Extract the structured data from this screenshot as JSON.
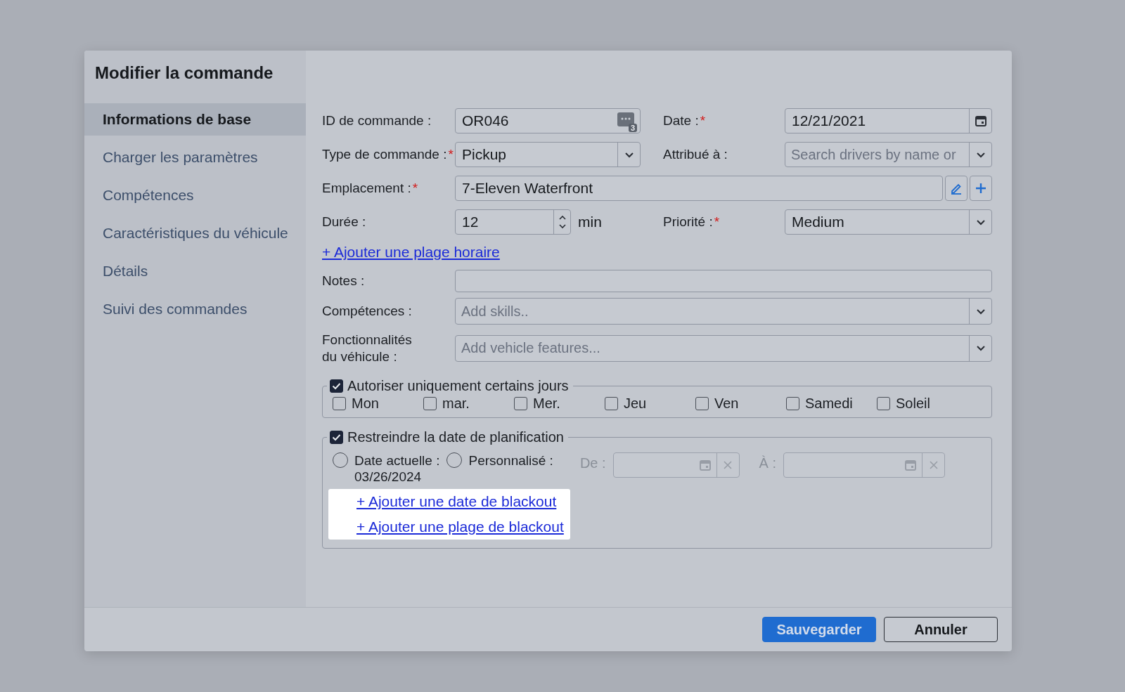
{
  "dialog": {
    "title": "Modifier la commande"
  },
  "sidebar": {
    "items": [
      {
        "label": "Informations de base",
        "selected": true
      },
      {
        "label": "Charger les paramètres",
        "selected": false
      },
      {
        "label": "Compétences",
        "selected": false
      },
      {
        "label": "Caractéristiques du véhicule",
        "selected": false
      },
      {
        "label": "Détails",
        "selected": false
      },
      {
        "label": "Suivi des commandes",
        "selected": false
      }
    ]
  },
  "form": {
    "order_id": {
      "label": "ID de commande :",
      "value": "OR046",
      "badge": "3"
    },
    "date": {
      "label": "Date :",
      "mark": "*",
      "value": "12/21/2021"
    },
    "order_type": {
      "label": "Type de commande :",
      "mark": "*",
      "value": "Pickup"
    },
    "assigned_to": {
      "label": "Attribué à :",
      "placeholder": "Search drivers by name or"
    },
    "location": {
      "label": "Emplacement :",
      "mark": "*",
      "value": "7-Eleven Waterfront"
    },
    "duration": {
      "label": "Durée :",
      "value": "12",
      "unit": "min"
    },
    "priority": {
      "label": "Priorité :",
      "mark": "*",
      "value": "Medium"
    },
    "add_time_window": "+ Ajouter une plage horaire",
    "notes": {
      "label": "Notes :"
    },
    "skills": {
      "label": "Compétences :",
      "placeholder": "Add skills.."
    },
    "vehicle_features": {
      "label": "Fonctionnalités du véhicule :",
      "placeholder": "Add vehicle features..."
    },
    "allowed_days": {
      "label": "Autoriser uniquement certains jours",
      "checked": true,
      "days": [
        {
          "label": "Mon",
          "checked": false
        },
        {
          "label": "mar.",
          "checked": false
        },
        {
          "label": "Mer.",
          "checked": false
        },
        {
          "label": "Jeu",
          "checked": false
        },
        {
          "label": "Ven",
          "checked": false
        },
        {
          "label": "Samedi",
          "checked": false
        },
        {
          "label": "Soleil",
          "checked": false
        }
      ]
    },
    "restrict_date": {
      "label": "Restreindre la date de planification",
      "checked": true,
      "options": [
        {
          "label": "Date actuelle :",
          "value": "03/26/2024",
          "selected": false
        },
        {
          "label": "Personnalisé :",
          "selected": false
        }
      ],
      "from": {
        "label": "De :",
        "disabled": true
      },
      "to": {
        "label": "À :",
        "disabled": true
      },
      "links": [
        "+ Ajouter une date de blackout",
        "+ Ajouter une plage de blackout"
      ]
    }
  },
  "buttons": [
    {
      "label": "Sauvegarder",
      "kind": "primary"
    },
    {
      "label": "Annuler",
      "kind": "secondary"
    }
  ]
}
